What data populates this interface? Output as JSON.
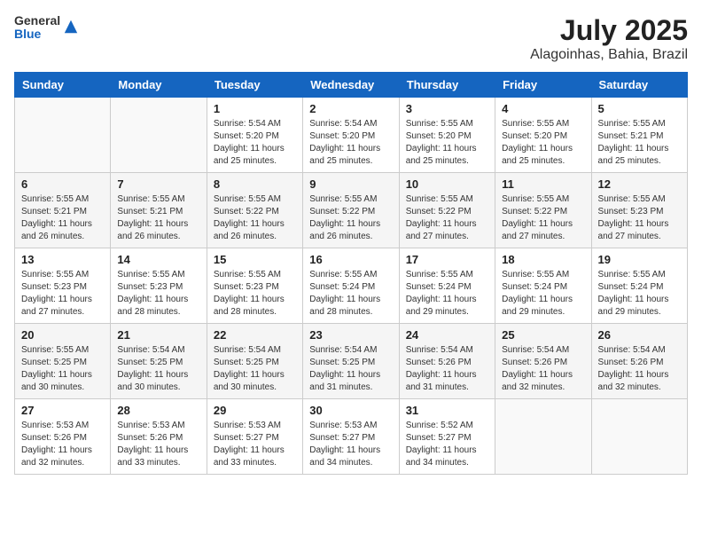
{
  "header": {
    "logo": {
      "general": "General",
      "blue": "Blue"
    },
    "title": "July 2025",
    "subtitle": "Alagoinhas, Bahia, Brazil"
  },
  "calendar": {
    "weekdays": [
      "Sunday",
      "Monday",
      "Tuesday",
      "Wednesday",
      "Thursday",
      "Friday",
      "Saturday"
    ],
    "weeks": [
      [
        {
          "day": "",
          "info": ""
        },
        {
          "day": "",
          "info": ""
        },
        {
          "day": "1",
          "info": "Sunrise: 5:54 AM\nSunset: 5:20 PM\nDaylight: 11 hours and 25 minutes."
        },
        {
          "day": "2",
          "info": "Sunrise: 5:54 AM\nSunset: 5:20 PM\nDaylight: 11 hours and 25 minutes."
        },
        {
          "day": "3",
          "info": "Sunrise: 5:55 AM\nSunset: 5:20 PM\nDaylight: 11 hours and 25 minutes."
        },
        {
          "day": "4",
          "info": "Sunrise: 5:55 AM\nSunset: 5:20 PM\nDaylight: 11 hours and 25 minutes."
        },
        {
          "day": "5",
          "info": "Sunrise: 5:55 AM\nSunset: 5:21 PM\nDaylight: 11 hours and 25 minutes."
        }
      ],
      [
        {
          "day": "6",
          "info": "Sunrise: 5:55 AM\nSunset: 5:21 PM\nDaylight: 11 hours and 26 minutes."
        },
        {
          "day": "7",
          "info": "Sunrise: 5:55 AM\nSunset: 5:21 PM\nDaylight: 11 hours and 26 minutes."
        },
        {
          "day": "8",
          "info": "Sunrise: 5:55 AM\nSunset: 5:22 PM\nDaylight: 11 hours and 26 minutes."
        },
        {
          "day": "9",
          "info": "Sunrise: 5:55 AM\nSunset: 5:22 PM\nDaylight: 11 hours and 26 minutes."
        },
        {
          "day": "10",
          "info": "Sunrise: 5:55 AM\nSunset: 5:22 PM\nDaylight: 11 hours and 27 minutes."
        },
        {
          "day": "11",
          "info": "Sunrise: 5:55 AM\nSunset: 5:22 PM\nDaylight: 11 hours and 27 minutes."
        },
        {
          "day": "12",
          "info": "Sunrise: 5:55 AM\nSunset: 5:23 PM\nDaylight: 11 hours and 27 minutes."
        }
      ],
      [
        {
          "day": "13",
          "info": "Sunrise: 5:55 AM\nSunset: 5:23 PM\nDaylight: 11 hours and 27 minutes."
        },
        {
          "day": "14",
          "info": "Sunrise: 5:55 AM\nSunset: 5:23 PM\nDaylight: 11 hours and 28 minutes."
        },
        {
          "day": "15",
          "info": "Sunrise: 5:55 AM\nSunset: 5:23 PM\nDaylight: 11 hours and 28 minutes."
        },
        {
          "day": "16",
          "info": "Sunrise: 5:55 AM\nSunset: 5:24 PM\nDaylight: 11 hours and 28 minutes."
        },
        {
          "day": "17",
          "info": "Sunrise: 5:55 AM\nSunset: 5:24 PM\nDaylight: 11 hours and 29 minutes."
        },
        {
          "day": "18",
          "info": "Sunrise: 5:55 AM\nSunset: 5:24 PM\nDaylight: 11 hours and 29 minutes."
        },
        {
          "day": "19",
          "info": "Sunrise: 5:55 AM\nSunset: 5:24 PM\nDaylight: 11 hours and 29 minutes."
        }
      ],
      [
        {
          "day": "20",
          "info": "Sunrise: 5:55 AM\nSunset: 5:25 PM\nDaylight: 11 hours and 30 minutes."
        },
        {
          "day": "21",
          "info": "Sunrise: 5:54 AM\nSunset: 5:25 PM\nDaylight: 11 hours and 30 minutes."
        },
        {
          "day": "22",
          "info": "Sunrise: 5:54 AM\nSunset: 5:25 PM\nDaylight: 11 hours and 30 minutes."
        },
        {
          "day": "23",
          "info": "Sunrise: 5:54 AM\nSunset: 5:25 PM\nDaylight: 11 hours and 31 minutes."
        },
        {
          "day": "24",
          "info": "Sunrise: 5:54 AM\nSunset: 5:26 PM\nDaylight: 11 hours and 31 minutes."
        },
        {
          "day": "25",
          "info": "Sunrise: 5:54 AM\nSunset: 5:26 PM\nDaylight: 11 hours and 32 minutes."
        },
        {
          "day": "26",
          "info": "Sunrise: 5:54 AM\nSunset: 5:26 PM\nDaylight: 11 hours and 32 minutes."
        }
      ],
      [
        {
          "day": "27",
          "info": "Sunrise: 5:53 AM\nSunset: 5:26 PM\nDaylight: 11 hours and 32 minutes."
        },
        {
          "day": "28",
          "info": "Sunrise: 5:53 AM\nSunset: 5:26 PM\nDaylight: 11 hours and 33 minutes."
        },
        {
          "day": "29",
          "info": "Sunrise: 5:53 AM\nSunset: 5:27 PM\nDaylight: 11 hours and 33 minutes."
        },
        {
          "day": "30",
          "info": "Sunrise: 5:53 AM\nSunset: 5:27 PM\nDaylight: 11 hours and 34 minutes."
        },
        {
          "day": "31",
          "info": "Sunrise: 5:52 AM\nSunset: 5:27 PM\nDaylight: 11 hours and 34 minutes."
        },
        {
          "day": "",
          "info": ""
        },
        {
          "day": "",
          "info": ""
        }
      ]
    ]
  }
}
